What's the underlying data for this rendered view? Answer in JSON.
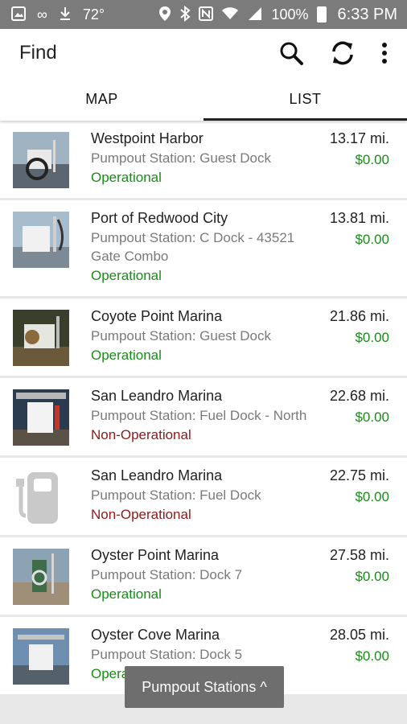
{
  "status_bar": {
    "temperature": "72°",
    "battery": "100%",
    "time": "6:33 PM"
  },
  "app_bar": {
    "title": "Find"
  },
  "tabs": [
    {
      "label": "MAP",
      "active": false
    },
    {
      "label": "LIST",
      "active": true
    }
  ],
  "stations": [
    {
      "name": "Westpoint Harbor",
      "desc": "Pumpout Station: Guest Dock",
      "status": "Operational",
      "distance": "13.17 mi.",
      "price": "$0.00"
    },
    {
      "name": "Port of Redwood City",
      "desc": "Pumpout Station: C Dock - 43521 Gate Combo",
      "status": "Operational",
      "distance": "13.81 mi.",
      "price": "$0.00"
    },
    {
      "name": "Coyote Point Marina",
      "desc": "Pumpout Station: Guest Dock",
      "status": "Operational",
      "distance": "21.86 mi.",
      "price": "$0.00"
    },
    {
      "name": "San Leandro Marina",
      "desc": "Pumpout Station: Fuel Dock - North",
      "status": "Non-Operational",
      "distance": "22.68 mi.",
      "price": "$0.00"
    },
    {
      "name": "San Leandro Marina",
      "desc": "Pumpout Station: Fuel Dock",
      "status": "Non-Operational",
      "distance": "22.75 mi.",
      "price": "$0.00"
    },
    {
      "name": "Oyster Point Marina",
      "desc": "Pumpout Station: Dock 7",
      "status": "Operational",
      "distance": "27.58 mi.",
      "price": "$0.00"
    },
    {
      "name": "Oyster Cove Marina",
      "desc": "Pumpout Station: Dock 5",
      "status": "Operational",
      "distance": "28.05 mi.",
      "price": "$0.00"
    }
  ],
  "toast": {
    "label": "Pumpout Stations ^"
  },
  "colors": {
    "status_bar": "#7b7b7b",
    "operational": "#1b8a1b",
    "non_operational": "#8b1a1a",
    "price": "#1b8a1b"
  }
}
